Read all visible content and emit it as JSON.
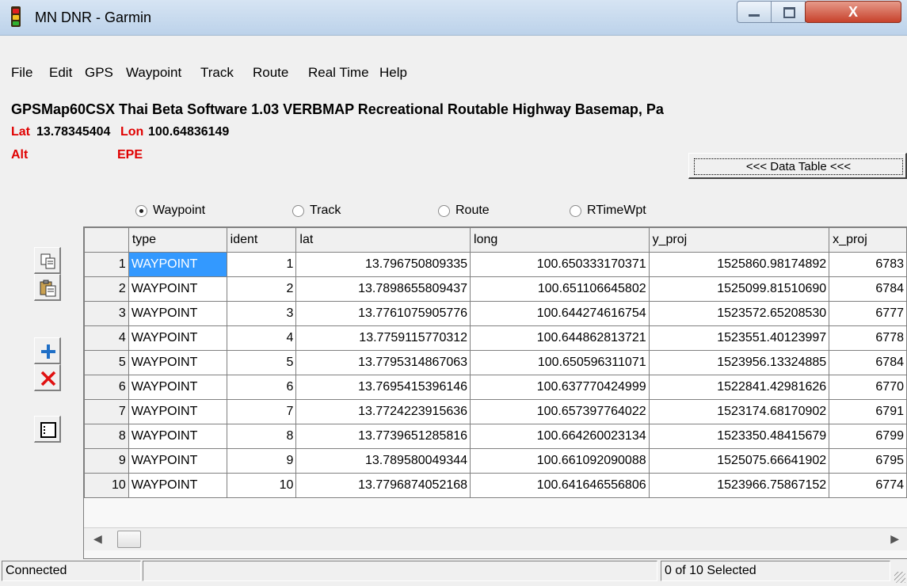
{
  "window": {
    "title": "MN DNR - Garmin",
    "close_glyph": "X"
  },
  "menu": [
    "File",
    "Edit",
    "GPS",
    "Waypoint",
    "Track",
    "Route",
    "Real Time",
    "Help"
  ],
  "gps": {
    "device_info": "GPSMap60CSX Thai Beta Software 1.03 VERBMAP Recreational Routable Highway Basemap, Pa",
    "lat_label": "Lat",
    "lat_value": "13.78345404",
    "lon_label": "Lon",
    "lon_value": "100.64836149",
    "alt_label": "Alt",
    "epe_label": "EPE"
  },
  "data_table_button": "<<< Data Table <<<",
  "radios": [
    {
      "label": "Waypoint",
      "selected": true
    },
    {
      "label": "Track",
      "selected": false
    },
    {
      "label": "Route",
      "selected": false
    },
    {
      "label": "RTimeWpt",
      "selected": false
    }
  ],
  "toolbar_icons": [
    "copy-icon",
    "paste-icon",
    "add-icon",
    "delete-icon",
    "properties-icon"
  ],
  "table": {
    "columns": [
      "type",
      "ident",
      "lat",
      "long",
      "y_proj",
      "x_proj"
    ],
    "rows": [
      [
        "1",
        "WAYPOINT",
        "1",
        "13.796750809335",
        "100.650333170371",
        "1525860.98174892",
        "6783"
      ],
      [
        "2",
        "WAYPOINT",
        "2",
        "13.7898655809437",
        "100.651106645802",
        "1525099.81510690",
        "6784"
      ],
      [
        "3",
        "WAYPOINT",
        "3",
        "13.7761075905776",
        "100.644274616754",
        "1523572.65208530",
        "6777"
      ],
      [
        "4",
        "WAYPOINT",
        "4",
        "13.7759115770312",
        "100.644862813721",
        "1523551.40123997",
        "6778"
      ],
      [
        "5",
        "WAYPOINT",
        "5",
        "13.7795314867063",
        "100.650596311071",
        "1523956.13324885",
        "6784"
      ],
      [
        "6",
        "WAYPOINT",
        "6",
        "13.7695415396146",
        "100.637770424999",
        "1522841.42981626",
        "6770"
      ],
      [
        "7",
        "WAYPOINT",
        "7",
        "13.7724223915636",
        "100.657397764022",
        "1523174.68170902",
        "6791"
      ],
      [
        "8",
        "WAYPOINT",
        "8",
        "13.7739651285816",
        "100.664260023134",
        "1523350.48415679",
        "6799"
      ],
      [
        "9",
        "WAYPOINT",
        "9",
        "13.789580049344",
        "100.661092090088",
        "1525075.66641902",
        "6795"
      ],
      [
        "10",
        "WAYPOINT",
        "10",
        "13.7796874052168",
        "100.641646556806",
        "1523966.75867152",
        "6774"
      ]
    ]
  },
  "status": {
    "left": "Connected",
    "middle": "",
    "right": "0 of 10 Selected"
  },
  "colors": {
    "label_red": "#e00000",
    "selection_blue": "#3399ff"
  }
}
